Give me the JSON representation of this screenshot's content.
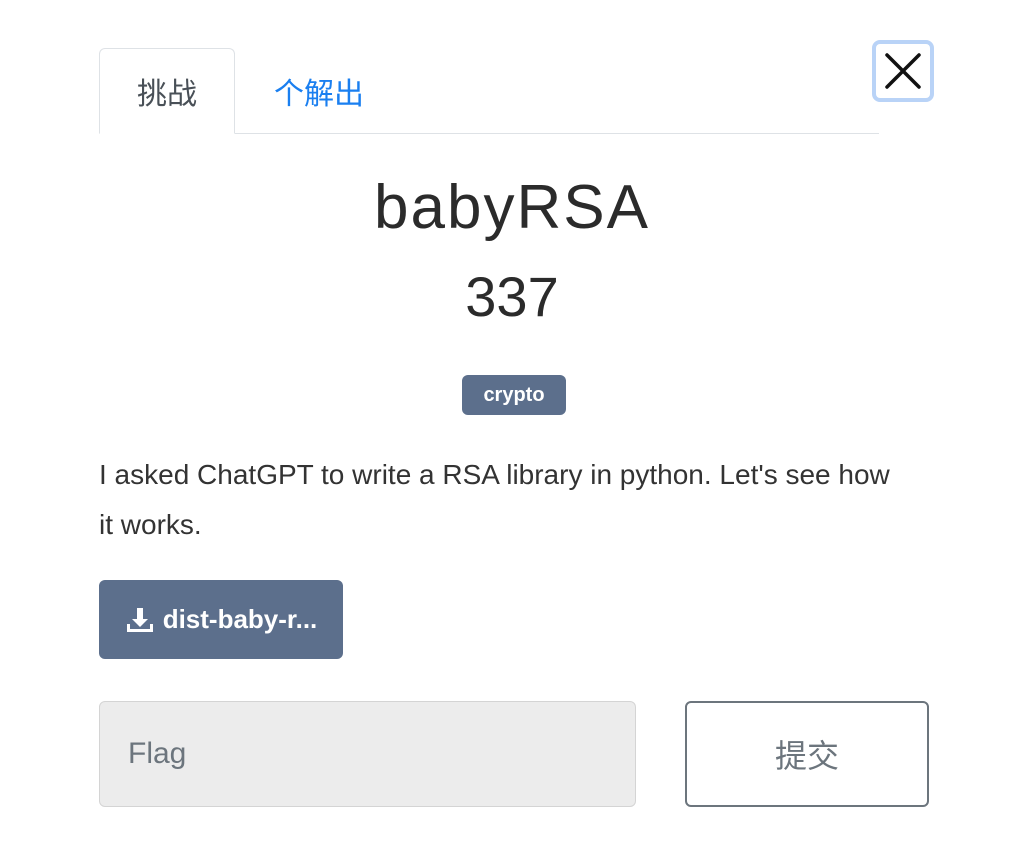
{
  "tabs": {
    "challenge": "挑战",
    "solves": "个解出"
  },
  "close": {
    "icon": "close-icon"
  },
  "challenge": {
    "name": "babyRSA",
    "points": "337",
    "tag": "crypto",
    "description": "I asked ChatGPT to write a RSA library in python. Let's see how it works."
  },
  "file": {
    "icon": "download-icon",
    "label": "dist-baby-r..."
  },
  "flag_input": {
    "placeholder": "Flag",
    "value": ""
  },
  "submit": {
    "label": "提交"
  },
  "colors": {
    "accent": "#1a7ff0",
    "tag_bg": "#5c6f8c",
    "input_bg": "#ececec"
  }
}
